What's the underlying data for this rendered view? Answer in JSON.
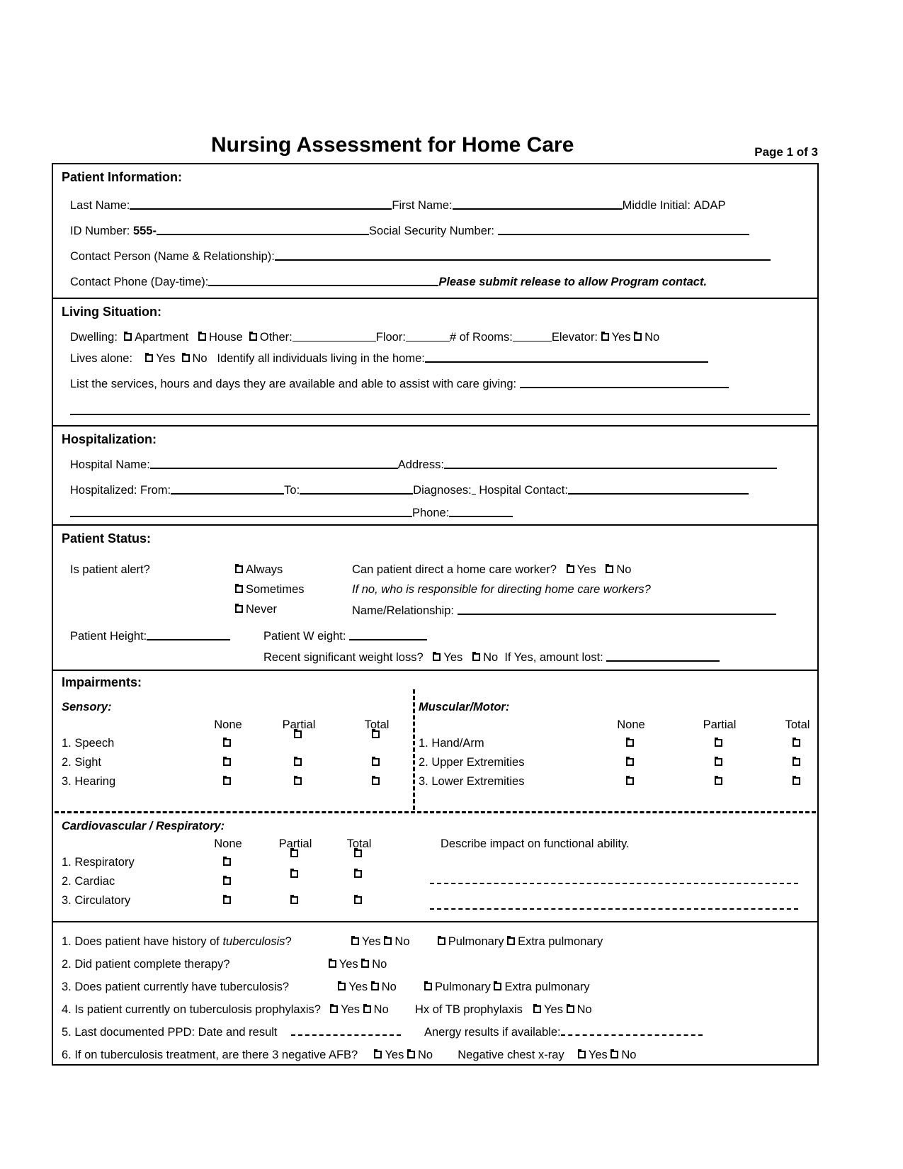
{
  "document": {
    "title": "Nursing Assessment for Home Care",
    "page_label": "Page 1 of 3"
  },
  "patient_information": {
    "heading": "Patient Information",
    "colon": ":",
    "last_name_label": "Last Name:",
    "first_name_label": "First Name:",
    "middle_initial_label": "Middle  Initial:",
    "program_code": "ADAP",
    "id_number_label": "ID Number:",
    "id_prefix": "555-",
    "ssn_label": "Social Security Number:",
    "contact_person_label": "Contact Person (Name  & Relationship):",
    "contact_phone_label": "Contact Phone (Day-time):",
    "release_note": "Please submit release to allow Program  contact."
  },
  "living_situation": {
    "heading": "Living Situation",
    "colon": ":",
    "dwelling_label": "Dwelling:",
    "dwelling_options": [
      "Apartment",
      "House",
      "Other:"
    ],
    "floor_label": "Floor:",
    "rooms_label": "# of Rooms:",
    "elevator_label": "Elevator:",
    "elevator_yes": "Yes",
    "elevator_no": "No",
    "lives_alone_label": "Lives alone:",
    "lives_alone_yes": "Yes",
    "lives_alone_no": "No",
    "identify_label": "Identify all individuals living in  the home:",
    "services_label": "List the services, hours and days they are available and able to assist with care giving:"
  },
  "hospitalization": {
    "heading": "Hospitalization",
    "colon": ":",
    "hospital_name_label": "Hospital Name:",
    "address_label": "Address:",
    "hospitalized_from_label": "Hospitalized:  From:",
    "to_label": "To:",
    "diagnoses_label": "Diagnoses:",
    "hospital_contact_label": "Hospital Contact:",
    "phone_label": "Phone:"
  },
  "patient_status": {
    "heading": "Patient Status",
    "colon": ":",
    "alert_question": "Is patient alert?",
    "alert_options": [
      "Always",
      "Sometimes",
      "Never"
    ],
    "direct_worker_question": "Can patient direct a  home care worker?",
    "direct_yes": "Yes",
    "direct_no": "No",
    "if_no_note": "If no, who is  responsible for directing home care  workers?",
    "name_relationship_label": "Name/Relationship:",
    "height_label": "Patient Height:",
    "weight_label": "Patient W eight:",
    "weight_loss_question": "Recent significant weight loss?",
    "weight_loss_yes": "Yes",
    "weight_loss_no": "No",
    "amount_lost_label": "If  Yes, amount lost:"
  },
  "impairments": {
    "heading": "Impairments",
    "colon": ":",
    "columns": [
      "None",
      "Partial",
      "Total"
    ],
    "sensory": {
      "title": "Sensory:",
      "rows": [
        "1. Speech",
        "2. Sight",
        "3. Hearing"
      ]
    },
    "muscular_motor": {
      "title": "Muscular/Motor:",
      "rows": [
        "1. Hand/Arm",
        "2. Upper Extremities",
        "3. Lower Extremities"
      ]
    },
    "cardiovascular_respiratory": {
      "title": "Cardiovascular / Respiratory:",
      "rows": [
        "1. Respiratory",
        "2. Cardiac",
        "3. Circulatory"
      ],
      "describe_label": "Describe impact on functional ability."
    }
  },
  "tuberculosis": {
    "q1_text_a": "1. Does patient have history  of ",
    "q1_text_italic": "tuberculosis",
    "q1_text_b": "?",
    "q1_yes": "Yes",
    "q1_no": "No",
    "q1_pulmonary": "Pulmonary",
    "q1_extra": "Extra  pulmonary",
    "q2_text": "2. Did patient  complete therapy?",
    "q2_yes": "Yes",
    "q2_no": "No",
    "q3_text": "3. Does patient currently have tuberculosis?",
    "q3_yes": "Yes",
    "q3_no": "No",
    "q3_pulmonary": "Pulmonary",
    "q3_extra": "Extra  pulmonary",
    "q4_text": "4. Is  patient currently on tuberculosis prophylaxis?",
    "q4_yes": "Yes",
    "q4_no": "No",
    "q4_hx_label": "Hx of TB prophylaxis",
    "q4_hx_yes": "Yes",
    "q4_hx_no": "No",
    "q5_text": "5. Last documented PPD: Date and  result",
    "q5_anergy_label": "Anergy results if  available:",
    "q6_text": "6. If on tuberculosis treatment, are there 3  negative AFB?",
    "q6_yes": "Yes",
    "q6_no": "No",
    "q6_xray_label": "Negative chest x-ray",
    "q6_xray_yes": "Yes",
    "q6_xray_no": "No"
  }
}
